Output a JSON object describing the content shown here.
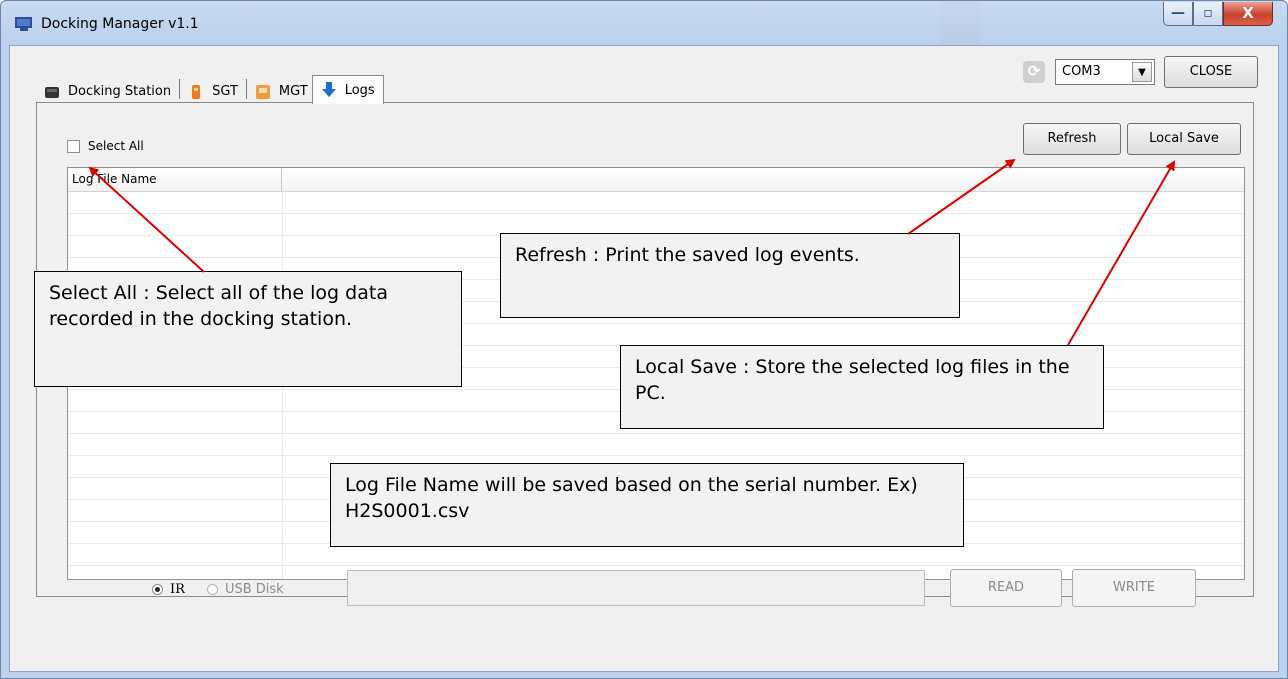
{
  "window": {
    "title": "Docking Manager v1.1",
    "caption_buttons": {
      "minimize": "—",
      "maximize": "▫",
      "close": "X"
    }
  },
  "toolbar": {
    "com_port": "COM3",
    "close_label": "CLOSE"
  },
  "tabs": [
    {
      "label": "Docking Station",
      "icon": "docking-station-icon",
      "active": false
    },
    {
      "label": "SGT",
      "icon": "sgt-device-icon",
      "active": false
    },
    {
      "label": "MGT",
      "icon": "mgt-device-icon",
      "active": false
    },
    {
      "label": "Logs",
      "icon": "down-arrow-icon",
      "active": true
    }
  ],
  "logs_panel": {
    "select_all_label": "Select All",
    "refresh_label": "Refresh",
    "local_save_label": "Local Save",
    "list_columns": [
      "Log File Name",
      ""
    ]
  },
  "bottom_bar": {
    "radio_ir_label": "IR",
    "radio_usb_label": "USB Disk",
    "path_value": "",
    "read_label": "READ",
    "write_label": "WRITE"
  },
  "annotations": {
    "select_all": "Select All : Select all of the log data recorded in the docking station.",
    "refresh": "Refresh : Print the saved log events.",
    "local_save": "Local Save : Store the selected log files in the PC.",
    "log_file_name": "Log File Name will be saved based on the serial number. Ex) H2S0001.csv"
  },
  "colors": {
    "annotation_arrow": "#e00000",
    "title_gradient": "#bcd1ee",
    "close_caption": "#c8412b"
  }
}
